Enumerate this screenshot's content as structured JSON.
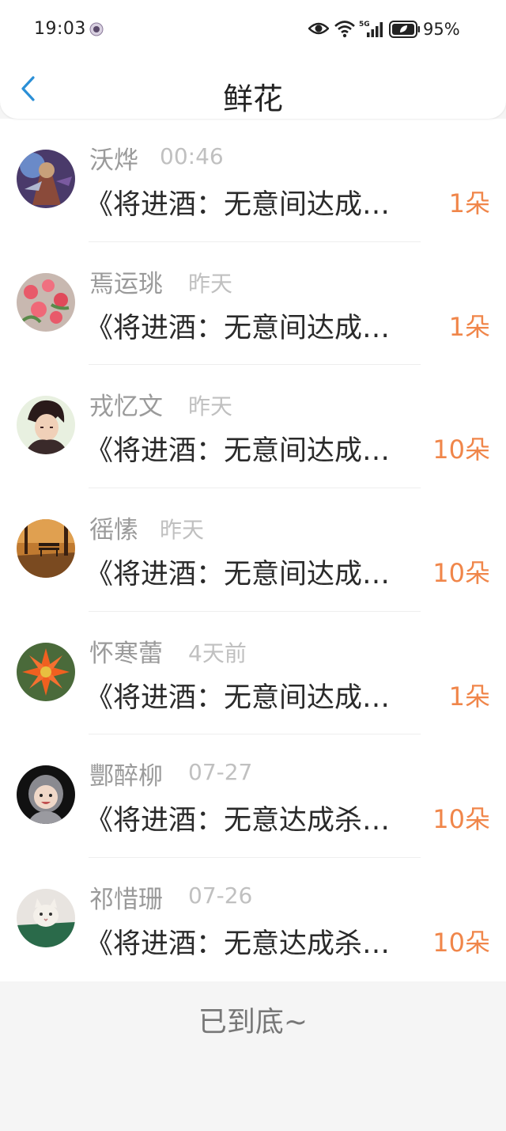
{
  "status_bar": {
    "time": "19:03",
    "battery": "95%",
    "icons": [
      "app-notification-icon",
      "eye-icon",
      "wifi-icon",
      "signal-5g-icon",
      "battery-icon"
    ]
  },
  "header": {
    "title": "鲜花",
    "back_icon": "chevron-left-icon"
  },
  "items": [
    {
      "name": "沃烨",
      "time": "00:46",
      "title": "《将进酒：无意间达成…",
      "count": "1朵",
      "avatar": "game-character-avatar"
    },
    {
      "name": "焉运珧",
      "time": "昨天",
      "title": "《将进酒：无意间达成…",
      "count": "1朵",
      "avatar": "roses-avatar"
    },
    {
      "name": "戎忆文",
      "time": "昨天",
      "title": "《将进酒：无意间达成…",
      "count": "10朵",
      "avatar": "anime-boy-avatar"
    },
    {
      "name": "徭愫",
      "time": "昨天",
      "title": "《将进酒：无意间达成…",
      "count": "10朵",
      "avatar": "park-bench-avatar"
    },
    {
      "name": "怀寒蕾",
      "time": "4天前",
      "title": "《将进酒：无意间达成…",
      "count": "1朵",
      "avatar": "orange-flower-avatar"
    },
    {
      "name": "酆醉柳",
      "time": "07-27",
      "title": "《将进酒：无意达成杀…",
      "count": "10朵",
      "avatar": "baby-avatar"
    },
    {
      "name": "祁惜珊",
      "time": "07-26",
      "title": "《将进酒：无意达成杀…",
      "count": "10朵",
      "avatar": "cat-avatar"
    }
  ],
  "footer": {
    "end_text": "已到底~"
  },
  "colors": {
    "accent": "#2b8fd6",
    "count": "#f0864a",
    "name": "#9a9a9a",
    "time": "#c0c0c0"
  }
}
